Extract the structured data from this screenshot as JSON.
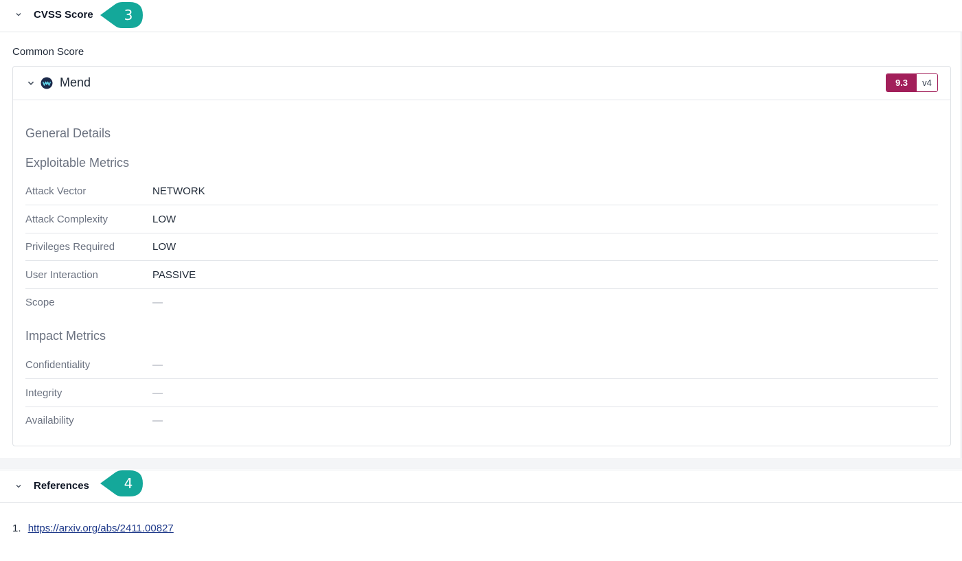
{
  "cvss_section": {
    "title": "CVSS Score",
    "step_number": "3",
    "common_score_label": "Common Score",
    "provider": {
      "name": "Mend",
      "score": "9.3",
      "version": "v4"
    },
    "general_details_title": "General Details",
    "exploitable_title": "Exploitable Metrics",
    "exploitable_metrics": [
      {
        "label": "Attack Vector",
        "value": "NETWORK"
      },
      {
        "label": "Attack Complexity",
        "value": "LOW"
      },
      {
        "label": "Privileges Required",
        "value": "LOW"
      },
      {
        "label": "User Interaction",
        "value": "PASSIVE"
      },
      {
        "label": "Scope",
        "value": "—"
      }
    ],
    "impact_title": "Impact Metrics",
    "impact_metrics": [
      {
        "label": "Confidentiality",
        "value": "—"
      },
      {
        "label": "Integrity",
        "value": "—"
      },
      {
        "label": "Availability",
        "value": "—"
      }
    ]
  },
  "references_section": {
    "title": "References",
    "step_number": "4",
    "items": [
      {
        "index": "1.",
        "url": "https://arxiv.org/abs/2411.00827"
      }
    ]
  },
  "colors": {
    "callout": "#14a89a",
    "score_badge": "#a21f5a"
  }
}
